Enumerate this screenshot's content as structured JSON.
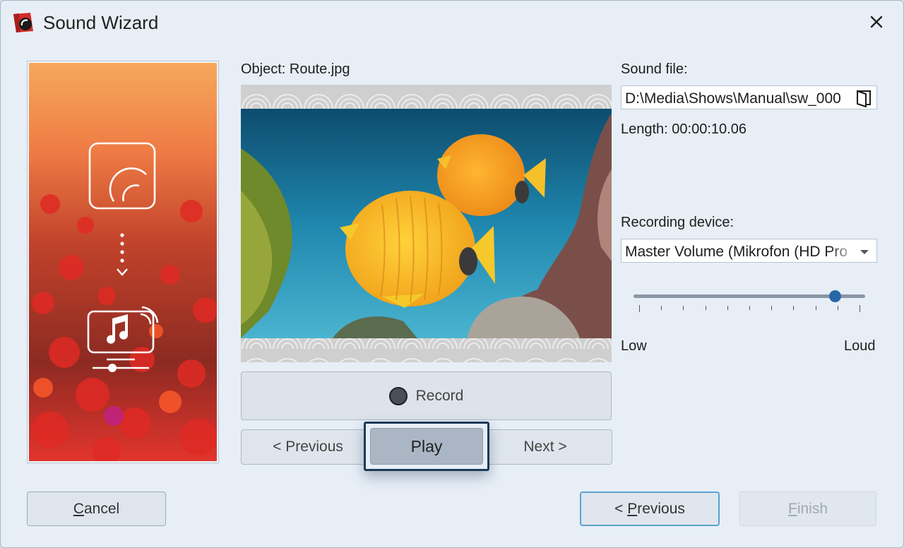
{
  "window": {
    "title": "Sound Wizard"
  },
  "preview": {
    "object_label": "Object: Route.jpg"
  },
  "controls": {
    "record_label": "Record",
    "previous_label": "< Previous",
    "play_label": "Play",
    "next_label": "Next >"
  },
  "sound": {
    "file_label": "Sound file:",
    "file_value": "D:\\Media\\Shows\\Manual\\sw_000",
    "length_text": "Length: 00:00:10.06"
  },
  "recording": {
    "device_label": "Recording device:",
    "device_value": "Master Volume (Mikrofon (HD Pro",
    "volume_fraction": 0.87,
    "low_label": "Low",
    "loud_label": "Loud"
  },
  "footer": {
    "cancel_first": "C",
    "cancel_rest": "ancel",
    "previous_prefix": "< ",
    "previous_first": "P",
    "previous_rest": "revious",
    "finish_first": "F",
    "finish_rest": "inish"
  },
  "colors": {
    "accent": "#2867a7",
    "focus_border": "#1b3a57"
  }
}
